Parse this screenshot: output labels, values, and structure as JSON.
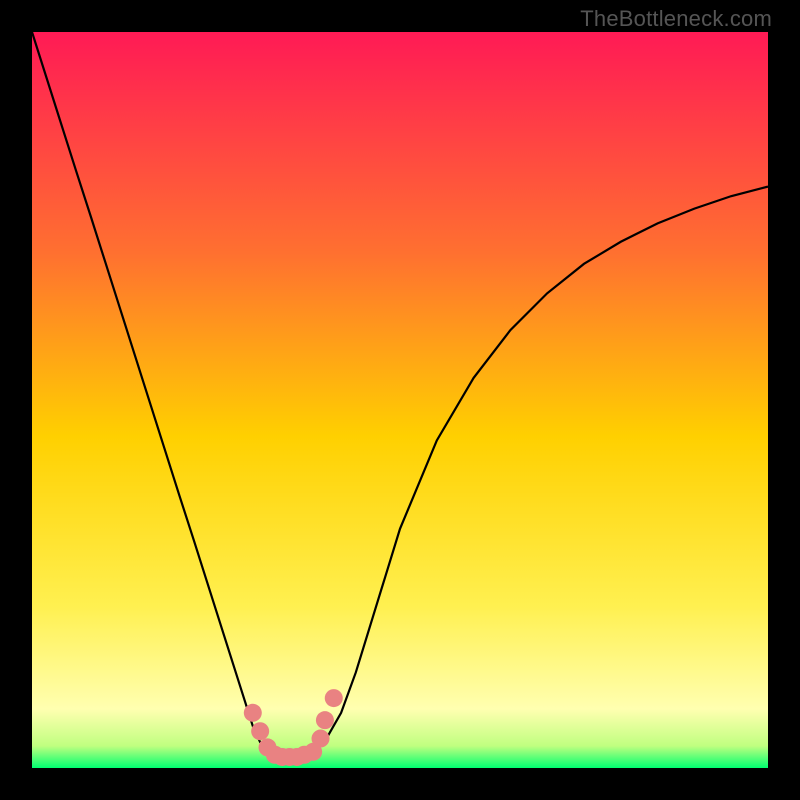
{
  "attribution": "TheBottleneck.com",
  "colors": {
    "bg_top": "#ff1a55",
    "bg_upper_mid": "#ff7030",
    "bg_mid": "#ffd000",
    "bg_lower_mid": "#fff050",
    "bg_near_bottom": "#ffffb0",
    "bg_bottom": "#00ff70",
    "curve": "#000000",
    "marker": "#e98282",
    "frame": "#000000"
  },
  "chart_data": {
    "type": "line",
    "title": "",
    "xlabel": "",
    "ylabel": "",
    "xlim": [
      0,
      1
    ],
    "ylim": [
      0,
      1
    ],
    "x": [
      0.0,
      0.02,
      0.04,
      0.06,
      0.08,
      0.1,
      0.12,
      0.14,
      0.16,
      0.18,
      0.2,
      0.22,
      0.24,
      0.26,
      0.28,
      0.3,
      0.31,
      0.32,
      0.33,
      0.34,
      0.35,
      0.36,
      0.38,
      0.4,
      0.42,
      0.44,
      0.46,
      0.48,
      0.5,
      0.55,
      0.6,
      0.65,
      0.7,
      0.75,
      0.8,
      0.85,
      0.9,
      0.95,
      1.0
    ],
    "values": [
      1.0,
      0.937,
      0.874,
      0.811,
      0.749,
      0.686,
      0.623,
      0.56,
      0.497,
      0.434,
      0.371,
      0.309,
      0.246,
      0.183,
      0.12,
      0.057,
      0.035,
      0.022,
      0.014,
      0.01,
      0.01,
      0.012,
      0.022,
      0.04,
      0.075,
      0.13,
      0.195,
      0.26,
      0.325,
      0.445,
      0.53,
      0.595,
      0.645,
      0.685,
      0.715,
      0.74,
      0.76,
      0.777,
      0.79
    ],
    "markers": {
      "x": [
        0.3,
        0.31,
        0.32,
        0.33,
        0.34,
        0.35,
        0.36,
        0.37,
        0.382,
        0.392,
        0.398,
        0.41
      ],
      "y": [
        0.075,
        0.05,
        0.028,
        0.018,
        0.015,
        0.015,
        0.015,
        0.018,
        0.022,
        0.04,
        0.065,
        0.095
      ]
    },
    "annotations": []
  }
}
